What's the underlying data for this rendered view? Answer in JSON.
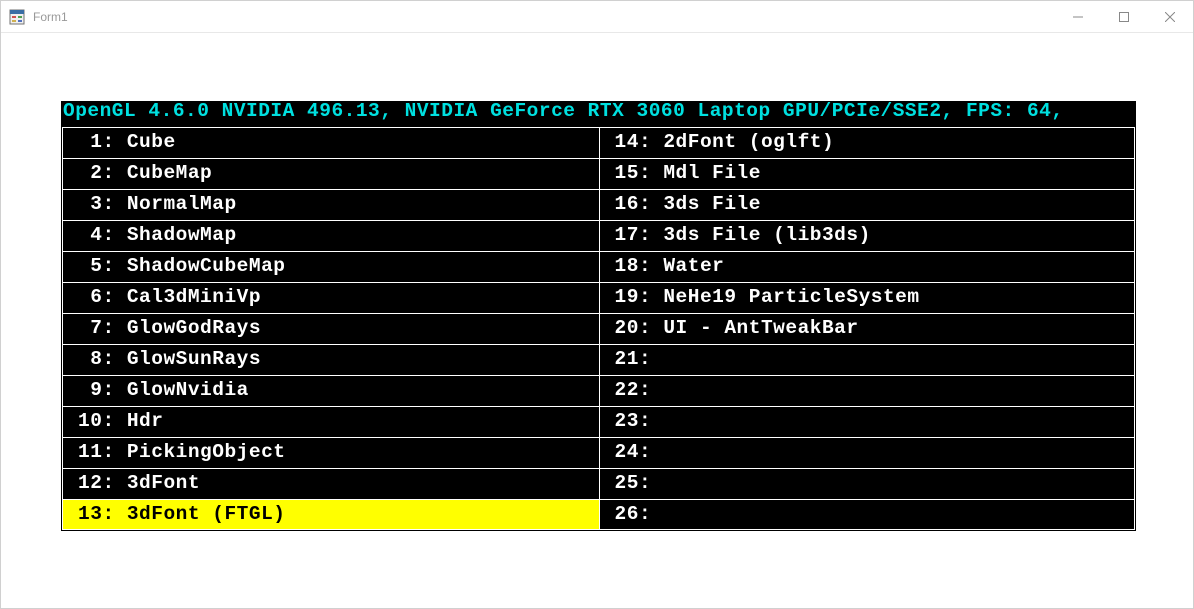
{
  "window": {
    "title": "Form1"
  },
  "glHeader": "OpenGL 4.6.0 NVIDIA 496.13, NVIDIA GeForce RTX 3060 Laptop GPU/PCIe/SSE2, FPS: 64,",
  "menu": {
    "selected": 13,
    "left": [
      {
        "n": "1",
        "label": "Cube"
      },
      {
        "n": "2",
        "label": "CubeMap"
      },
      {
        "n": "3",
        "label": "NormalMap"
      },
      {
        "n": "4",
        "label": "ShadowMap"
      },
      {
        "n": "5",
        "label": "ShadowCubeMap"
      },
      {
        "n": "6",
        "label": "Cal3dMiniVp"
      },
      {
        "n": "7",
        "label": "GlowGodRays"
      },
      {
        "n": "8",
        "label": "GlowSunRays"
      },
      {
        "n": "9",
        "label": "GlowNvidia"
      },
      {
        "n": "10",
        "label": "Hdr"
      },
      {
        "n": "11",
        "label": "PickingObject"
      },
      {
        "n": "12",
        "label": "3dFont"
      },
      {
        "n": "13",
        "label": "3dFont (FTGL)"
      }
    ],
    "right": [
      {
        "n": "14",
        "label": "2dFont (oglft)"
      },
      {
        "n": "15",
        "label": "Mdl File"
      },
      {
        "n": "16",
        "label": "3ds File"
      },
      {
        "n": "17",
        "label": "3ds File (lib3ds)"
      },
      {
        "n": "18",
        "label": "Water"
      },
      {
        "n": "19",
        "label": "NeHe19 ParticleSystem"
      },
      {
        "n": "20",
        "label": "UI - AntTweakBar"
      },
      {
        "n": "21",
        "label": ""
      },
      {
        "n": "22",
        "label": ""
      },
      {
        "n": "23",
        "label": ""
      },
      {
        "n": "24",
        "label": ""
      },
      {
        "n": "25",
        "label": ""
      },
      {
        "n": "26",
        "label": ""
      }
    ]
  }
}
